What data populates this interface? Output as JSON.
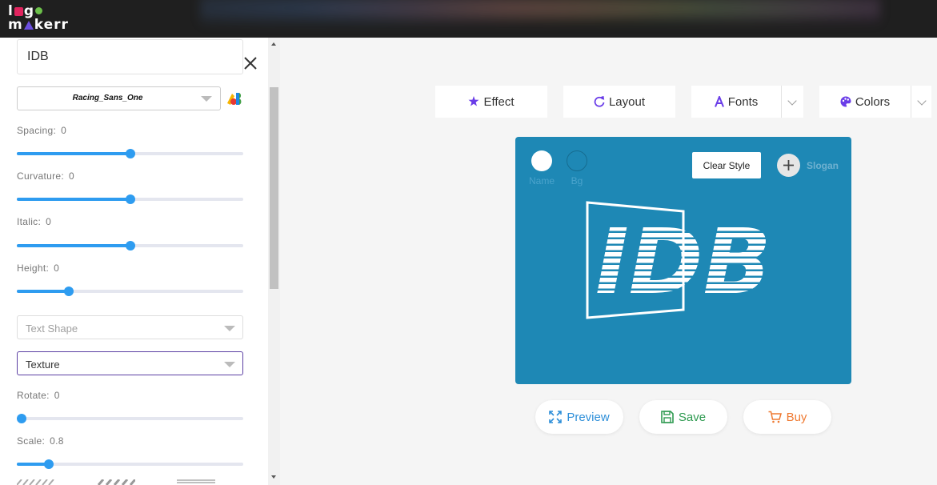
{
  "app": {
    "logo_top": "lgo",
    "logo_bottom": "makerr"
  },
  "editor": {
    "name_value": "IDB",
    "font_name": "Racing_Sans_One",
    "sliders": [
      {
        "label": "Spacing:",
        "value": "0",
        "fraction": 0.5
      },
      {
        "label": "Curvature:",
        "value": "0",
        "fraction": 0.5
      },
      {
        "label": "Italic:",
        "value": "0",
        "fraction": 0.5
      },
      {
        "label": "Height:",
        "value": "0",
        "fraction": 0.23
      },
      {
        "label": "Rotate:",
        "value": "0",
        "fraction": 0.0
      },
      {
        "label": "Scale:",
        "value": "0.8",
        "fraction": 0.14
      }
    ],
    "text_shape_placeholder": "Text Shape",
    "texture_value": "Texture"
  },
  "toolbar": {
    "effect": "Effect",
    "layout": "Layout",
    "fonts": "Fonts",
    "colors": "Colors"
  },
  "canvas": {
    "background_color": "#1e88b5",
    "name_swatch_label": "Name",
    "bg_swatch_label": "Bg",
    "clear_style": "Clear Style",
    "slogan": "Slogan",
    "logo_text": "IDB"
  },
  "actions": {
    "preview": "Preview",
    "save": "Save",
    "buy": "Buy"
  },
  "colors": {
    "slider_accent": "#2e9cf0",
    "preview": "#2e8fd9",
    "save": "#2e9a50",
    "buy": "#ef7a32",
    "toolbar_icon": "#6a3de8"
  }
}
